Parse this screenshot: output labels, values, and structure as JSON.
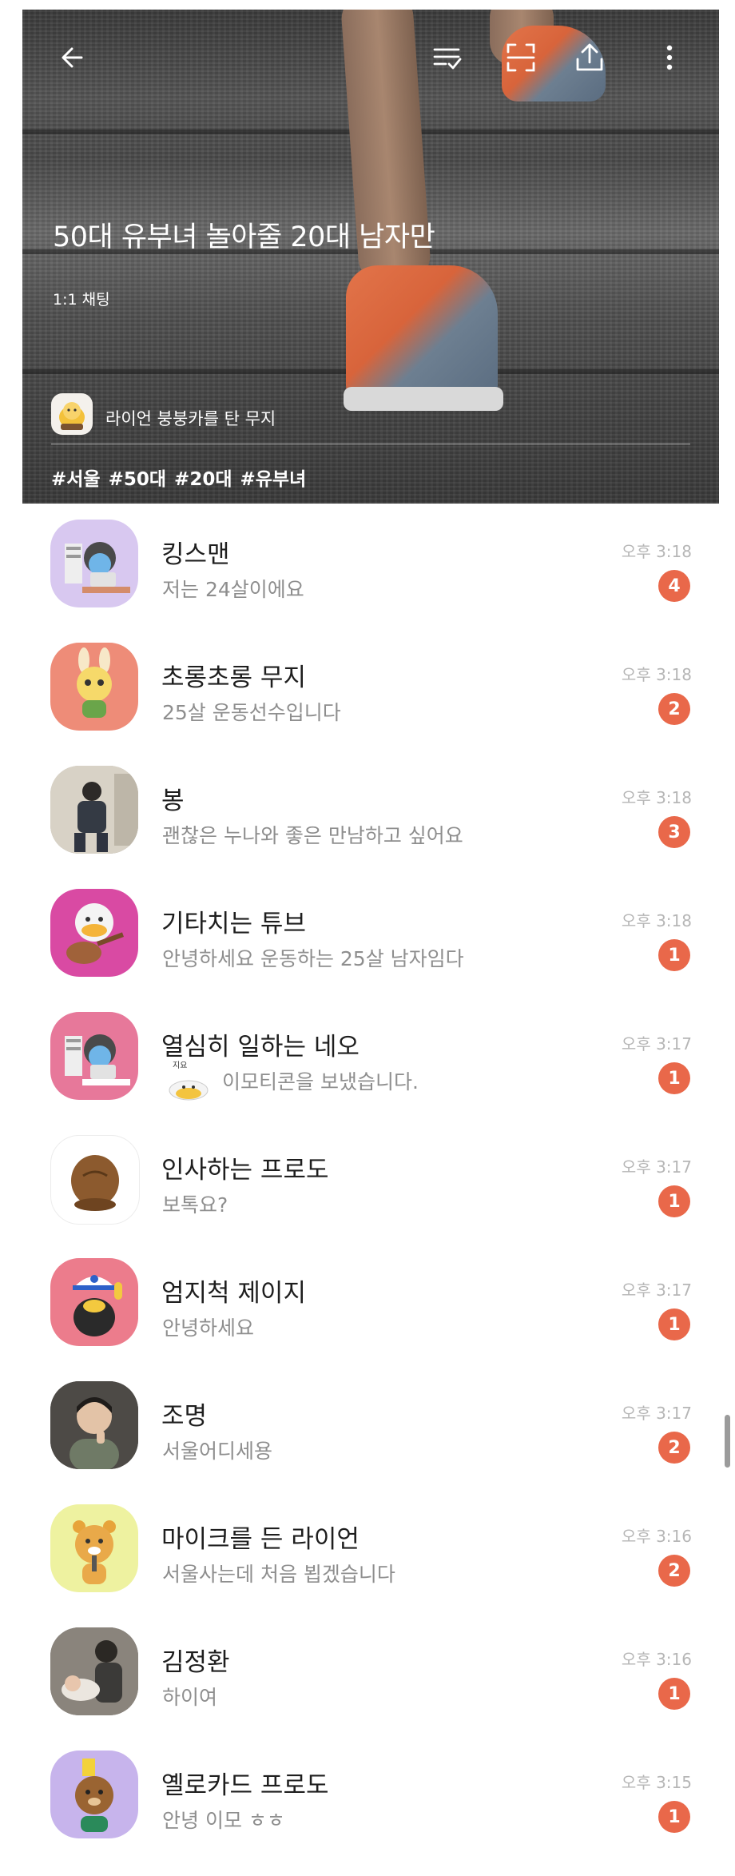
{
  "header": {
    "title": "50대 유부녀 놀아줄 20대 남자만",
    "subtitle": "1:1 채팅",
    "owner_name": "라이언 붕붕카를 탄 무지",
    "tags": [
      "#서울",
      "#50대",
      "#20대",
      "#유부녀"
    ],
    "icons": [
      "back-arrow-icon",
      "filter-check-icon",
      "scan-icon",
      "share-upload-icon",
      "more-vertical-icon"
    ]
  },
  "chats": [
    {
      "name": "킹스맨",
      "message": "저는 24살이에요",
      "time": "오후 3:18",
      "unread": "4",
      "avatar": "neo-laptop"
    },
    {
      "name": "초롱초롱 무지",
      "message": "25살 운동선수입니다",
      "time": "오후 3:18",
      "unread": "2",
      "avatar": "muzi"
    },
    {
      "name": "봉",
      "message": "괜찮은 누나와 좋은 만남하고 싶어요",
      "time": "오후 3:18",
      "unread": "3",
      "avatar": "photo-subway"
    },
    {
      "name": "기타치는 튜브",
      "message": "안녕하세요 운동하는 25살 남자임다",
      "time": "오후 3:18",
      "unread": "1",
      "avatar": "tube-guitar"
    },
    {
      "name": "열심히 일하는 네오",
      "message": "이모티콘을 보냈습니다.",
      "time": "오후 3:17",
      "unread": "1",
      "avatar": "neo-laptop",
      "emoticon": true,
      "emoticon_text": "지요"
    },
    {
      "name": "인사하는 프로도",
      "message": "보톡요?",
      "time": "오후 3:17",
      "unread": "1",
      "avatar": "frodo-back"
    },
    {
      "name": "엄지척 제이지",
      "message": "안녕하세요",
      "time": "오후 3:17",
      "unread": "1",
      "avatar": "jayg"
    },
    {
      "name": "조명",
      "message": "서울어디세용",
      "time": "오후 3:17",
      "unread": "2",
      "avatar": "photo-man"
    },
    {
      "name": "마이크를 든 라이언",
      "message": "서울사는데 처음 뵙겠습니다",
      "time": "오후 3:16",
      "unread": "2",
      "avatar": "ryan-mic"
    },
    {
      "name": "김정환",
      "message": "하이여",
      "time": "오후 3:16",
      "unread": "1",
      "avatar": "photo-baby"
    },
    {
      "name": "옐로카드 프로도",
      "message": "안녕 이모 ㅎㅎ",
      "time": "오후 3:15",
      "unread": "1",
      "avatar": "frodo-card"
    }
  ],
  "colors": {
    "badge": "#e9684a",
    "time": "#b6b6b6",
    "message": "#8e8e8e",
    "name": "#1e1e1e"
  }
}
